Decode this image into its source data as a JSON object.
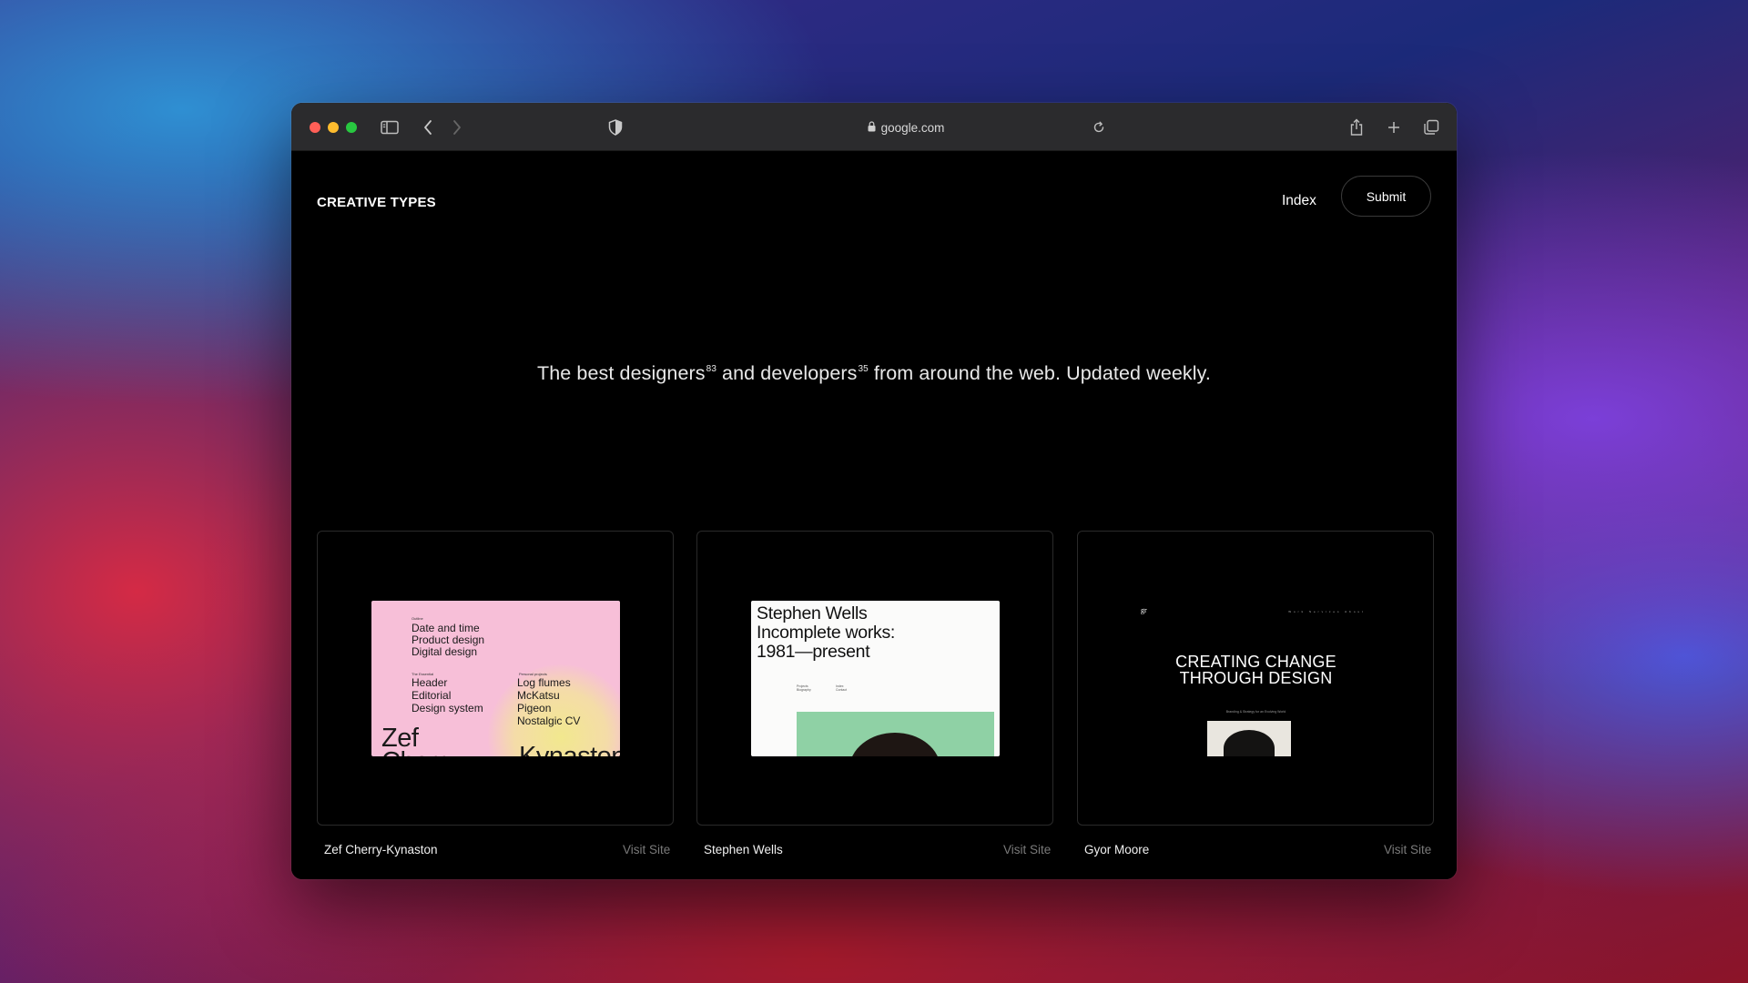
{
  "browser": {
    "address": "google.com",
    "icons": [
      "sidebar-icon",
      "back-icon",
      "forward-icon",
      "shield-icon",
      "lock-icon",
      "reload-icon",
      "share-icon",
      "new-tab-icon",
      "tabs-icon"
    ]
  },
  "site": {
    "logo": "CREATIVE TYPES",
    "nav": {
      "index": "Index",
      "submit": "Submit"
    },
    "tagline": {
      "part1": "The best designers",
      "designers_count": "83",
      "part2": " and developers",
      "developers_count": "35",
      "part3": " from around the web. Updated weekly."
    },
    "cards": [
      {
        "name": "Zef Cherry-Kynaston",
        "visit": "Visit Site",
        "thumb": {
          "label_top": "Outline",
          "items_top": [
            "Date and time",
            "Product design",
            "Digital design"
          ],
          "label_left": "The Essential",
          "items_left": [
            "Header",
            "Editorial",
            "Design system"
          ],
          "label_right": "Personal projects",
          "items_right": [
            "Log flumes",
            "McKatsu",
            "Pigeon",
            "Nostalgic CV"
          ],
          "big_left": "Zef\nCherry",
          "big_right": "Kynaston"
        }
      },
      {
        "name": "Stephen Wells",
        "visit": "Visit Site",
        "thumb": {
          "title_line1": "Stephen Wells",
          "title_line2": "Incomplete works:",
          "title_line3": "1981—present",
          "col1": "Projects\nBiography",
          "col2": "Index\nContact"
        }
      },
      {
        "name": "Gyor Moore",
        "visit": "Visit Site",
        "thumb": {
          "mark": "gr",
          "nav": "Work Services About",
          "hero_line1": "CREATING CHANGE",
          "hero_line2": "THROUGH DESIGN",
          "sub": "Branding & Strategy for an Evolving World"
        }
      }
    ]
  }
}
